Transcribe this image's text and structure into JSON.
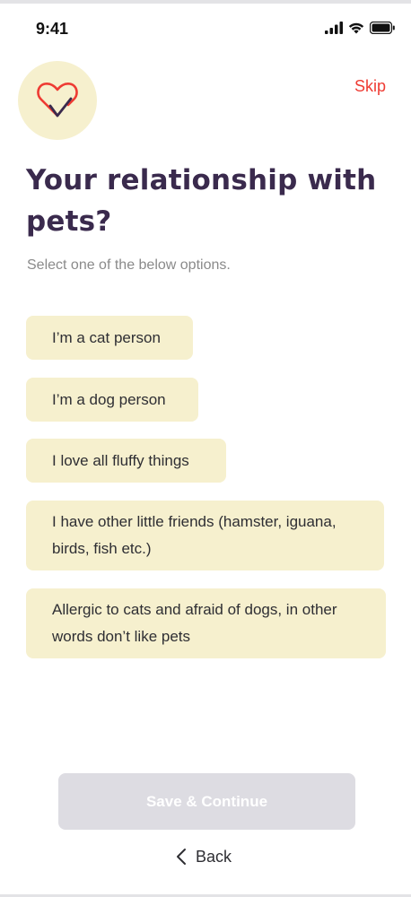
{
  "status": {
    "time": "9:41"
  },
  "header": {
    "skip_label": "Skip"
  },
  "question": {
    "title": "Your relationship with pets?",
    "subtitle": "Select one of the below options."
  },
  "options": [
    {
      "label": "I’m a cat person"
    },
    {
      "label": "I’m a dog person"
    },
    {
      "label": "I love all fluffy things"
    },
    {
      "label": "I have other little friends (hamster, iguana, birds, fish etc.)"
    },
    {
      "label": "Allergic to cats and afraid of dogs, in other words don’t like pets"
    }
  ],
  "footer": {
    "save_label": "Save & Continue",
    "back_label": "Back"
  },
  "colors": {
    "accent": "#ee3b33",
    "option_bg": "#f6f0ce",
    "title": "#3a2a4d",
    "button_disabled": "#dddce2"
  },
  "icons": [
    "signal-icon",
    "wifi-icon",
    "battery-icon",
    "heart-check-icon",
    "chevron-left-icon"
  ]
}
